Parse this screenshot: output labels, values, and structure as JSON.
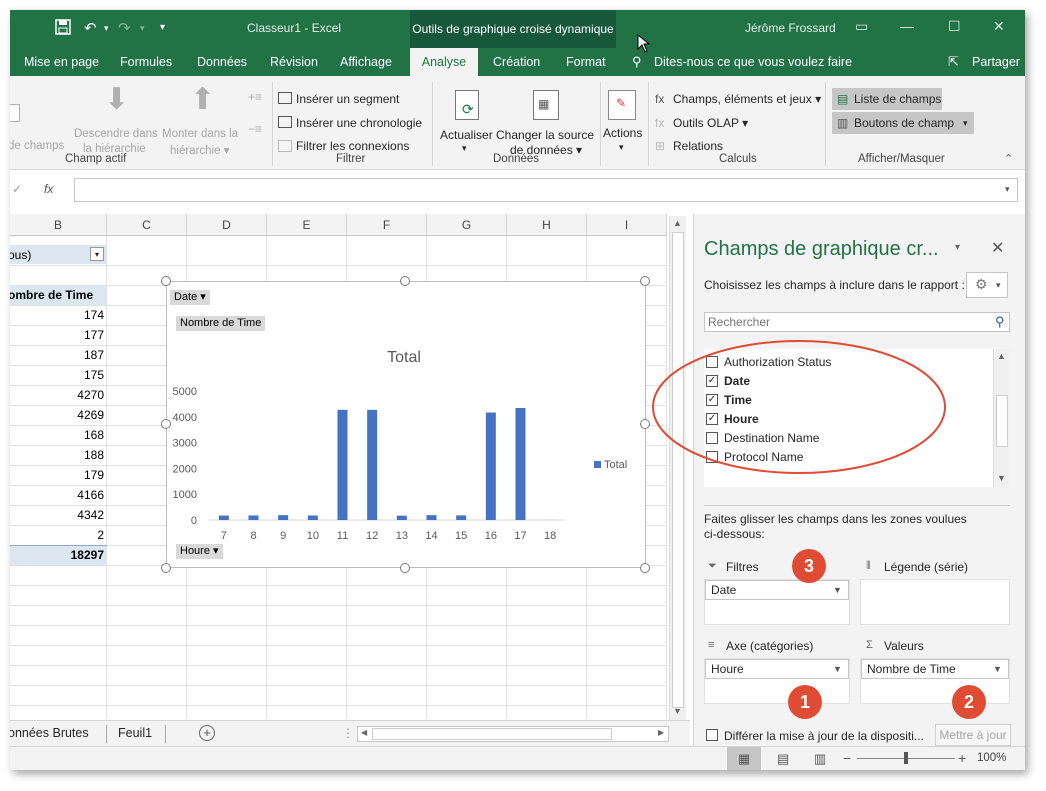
{
  "titlebar": {
    "doc_title": "Classeur1  -  Excel",
    "context_tab": "Outils de graphique croisé dynamique",
    "user": "Jérôme Frossard"
  },
  "tabs": [
    "Mise en page",
    "Formules",
    "Données",
    "Révision",
    "Affichage",
    "Analyse",
    "Création",
    "Format"
  ],
  "tell_me": "Dites-nous ce que vous voulez faire",
  "share": "Partager",
  "ribbon": {
    "active_field": {
      "partial": "de champs",
      "drill_down": "Descendre dans",
      "drill_down2": "la hiérarchie",
      "drill_up": "Monter dans la",
      "drill_up2": "hiérarchie ▾",
      "group": "Champ actif"
    },
    "filter": {
      "slicer": "Insérer un segment",
      "timeline": "Insérer une chronologie",
      "connections": "Filtrer les connexions",
      "group": "Filtrer"
    },
    "data": {
      "refresh": "Actualiser",
      "refresh_arrow": "▾",
      "change": "Changer la source",
      "change2": "de données ▾",
      "group": "Données"
    },
    "actions": {
      "label": "Actions",
      "arrow": "▾"
    },
    "calc": {
      "fields": "Champs, éléments et jeux ▾",
      "olap": "Outils OLAP ▾",
      "relations": "Relations",
      "group": "Calculs"
    },
    "show": {
      "field_list": "Liste de champs",
      "field_buttons": "Boutons de champ",
      "group": "Afficher/Masquer"
    }
  },
  "formula": {
    "fx": "fx"
  },
  "columns": [
    "B",
    "C",
    "D",
    "E",
    "F",
    "G",
    "H",
    "I"
  ],
  "cells": {
    "filter_cell": "ous)",
    "header": "ombre de Time",
    "values": [
      "174",
      "177",
      "187",
      "175",
      "4270",
      "4269",
      "168",
      "188",
      "179",
      "4166",
      "4342",
      "2"
    ],
    "total": "18297"
  },
  "chart": {
    "date_btn": "Date ▾",
    "value_btn": "Nombre de Time",
    "houre_btn": "Houre ▾",
    "legend": "Total"
  },
  "chart_data": {
    "type": "bar",
    "title": "Total",
    "categories": [
      "7",
      "8",
      "9",
      "10",
      "11",
      "12",
      "13",
      "14",
      "15",
      "16",
      "17",
      "18"
    ],
    "series": [
      {
        "name": "Total",
        "values": [
          174,
          177,
          187,
          175,
          4270,
          4269,
          168,
          188,
          179,
          4166,
          4342,
          2
        ]
      }
    ],
    "yticks": [
      "0",
      "1000",
      "2000",
      "3000",
      "4000",
      "5000"
    ],
    "ylim": [
      0,
      5000
    ],
    "color": "#4472c4",
    "legend": "right"
  },
  "sheets": [
    "onnées Brutes",
    "Feuil1"
  ],
  "pane": {
    "title": "Champs de graphique cr...",
    "choose": "Choisissez les champs à inclure dans le rapport :",
    "search_placeholder": "Rechercher",
    "fields": [
      {
        "label": "Authorization Status",
        "checked": false
      },
      {
        "label": "Date",
        "checked": true
      },
      {
        "label": "Time",
        "checked": true
      },
      {
        "label": "Houre",
        "checked": true
      },
      {
        "label": "Destination Name",
        "checked": false
      },
      {
        "label": "Protocol Name",
        "checked": false
      }
    ],
    "drag_hint": "Faites glisser les champs dans les zones voulues ci-dessous:",
    "filters_label": "Filtres",
    "legend_label": "Légende (série)",
    "axis_label": "Axe (catégories)",
    "values_label": "Valeurs",
    "filters_value": "Date",
    "axis_value": "Houre",
    "values_value": "Nombre de Time",
    "defer": "Différer la mise à jour de la dispositi...",
    "update": "Mettre à jour"
  },
  "badges": [
    "1",
    "2",
    "3"
  ],
  "status": {
    "zoom": "100%"
  },
  "accent": "#217346",
  "annotation_color": "#e04b33"
}
